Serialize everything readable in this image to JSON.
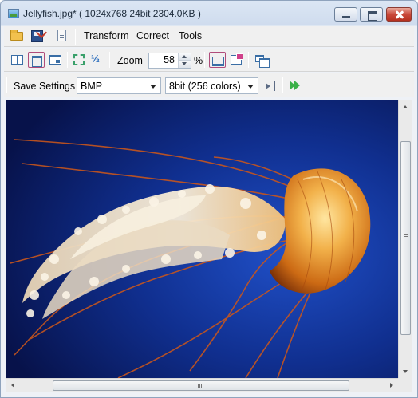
{
  "window": {
    "title": "Jellyfish.jpg*  ( 1024x768  24bit  2304.0KB )"
  },
  "menu": {
    "transform": "Transform",
    "correct": "Correct",
    "tools": "Tools"
  },
  "zoom": {
    "label": "Zoom",
    "value": "58",
    "unit": "%"
  },
  "save": {
    "label": "Save Settings",
    "format": "BMP",
    "bit_depth": "8bit (256 colors)"
  },
  "colors": {
    "background_top": "#0a1a5e",
    "jellyfish_bell": "#e0871a",
    "tentacles": "#f3e6cf"
  }
}
